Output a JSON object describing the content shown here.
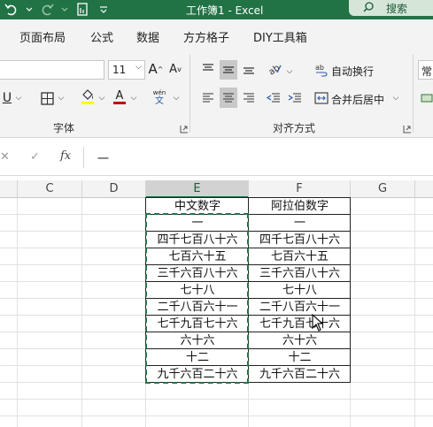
{
  "window": {
    "title": "工作簿1 - Excel",
    "search_label": "搜索"
  },
  "tabs": [
    "页面布局",
    "公式",
    "数据",
    "方方格子",
    "DIY工具箱"
  ],
  "ribbon": {
    "font_size": "11",
    "wrap_text": "自动换行",
    "merge_center": "合并后居中",
    "number_format_partial": "常",
    "group_font": "字体",
    "group_alignment": "对齐方式",
    "phonetic_top": "wén",
    "phonetic_bottom": "文",
    "font_color": "#c00000",
    "highlight_color": "#ffff00"
  },
  "formula_bar": {
    "fx": "fx",
    "content": "一"
  },
  "columns": [
    "C",
    "D",
    "E",
    "F",
    "G"
  ],
  "table": {
    "headers": [
      "中文数字",
      "阿拉伯数字"
    ],
    "rows": [
      [
        "一",
        "一"
      ],
      [
        "四千七百八十六",
        "四千七百八十六"
      ],
      [
        "七百六十五",
        "七百六十五"
      ],
      [
        "三千六百八十六",
        "三千六百八十六"
      ],
      [
        "七十八",
        "七十八"
      ],
      [
        "二千八百六十一",
        "二千八百六十一"
      ],
      [
        "七千九百七十六",
        "七千九百七十六"
      ],
      [
        "六十六",
        "六十六"
      ],
      [
        "十二",
        "十二"
      ],
      [
        "九千六百二十六",
        "九千六百二十六"
      ]
    ]
  }
}
